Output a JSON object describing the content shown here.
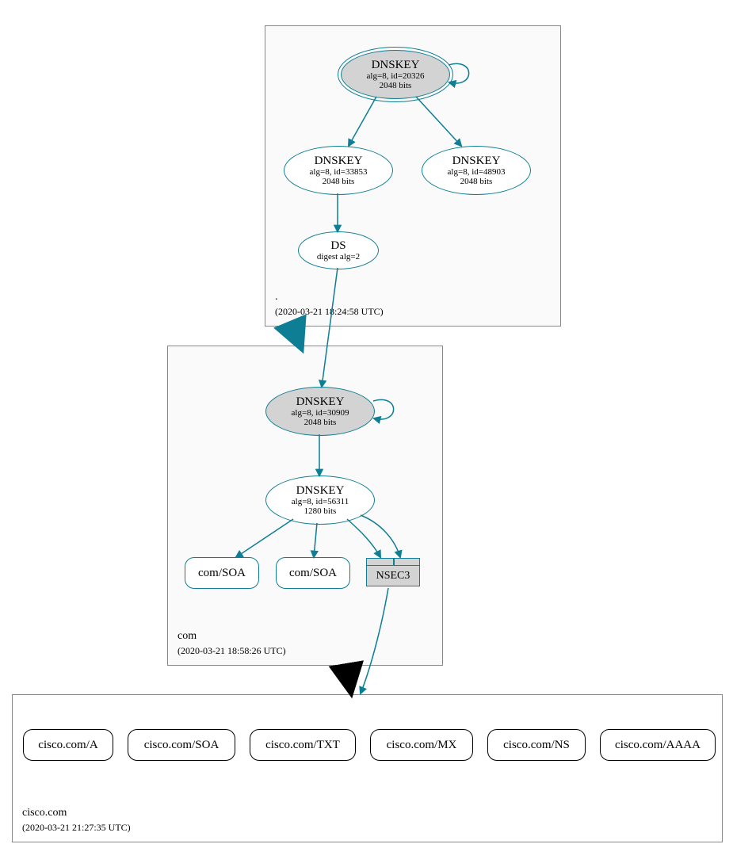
{
  "zones": {
    "root": {
      "label": ".",
      "timestamp": "(2020-03-21 18:24:58 UTC)"
    },
    "com": {
      "label": "com",
      "timestamp": "(2020-03-21 18:58:26 UTC)"
    },
    "cisco": {
      "label": "cisco.com",
      "timestamp": "(2020-03-21 21:27:35 UTC)"
    }
  },
  "nodes": {
    "root_ksk": {
      "title": "DNSKEY",
      "line2": "alg=8, id=20326",
      "line3": "2048 bits"
    },
    "root_zsk1": {
      "title": "DNSKEY",
      "line2": "alg=8, id=33853",
      "line3": "2048 bits"
    },
    "root_zsk2": {
      "title": "DNSKEY",
      "line2": "alg=8, id=48903",
      "line3": "2048 bits"
    },
    "root_ds": {
      "title": "DS",
      "line2": "digest alg=2"
    },
    "com_ksk": {
      "title": "DNSKEY",
      "line2": "alg=8, id=30909",
      "line3": "2048 bits"
    },
    "com_zsk": {
      "title": "DNSKEY",
      "line2": "alg=8, id=56311",
      "line3": "1280 bits"
    },
    "com_soa1": {
      "label": "com/SOA"
    },
    "com_soa2": {
      "label": "com/SOA"
    },
    "nsec3": {
      "label": "NSEC3"
    },
    "cisco_a": {
      "label": "cisco.com/A"
    },
    "cisco_soa": {
      "label": "cisco.com/SOA"
    },
    "cisco_txt": {
      "label": "cisco.com/TXT"
    },
    "cisco_mx": {
      "label": "cisco.com/MX"
    },
    "cisco_ns": {
      "label": "cisco.com/NS"
    },
    "cisco_aaaa": {
      "label": "cisco.com/AAAA"
    }
  }
}
